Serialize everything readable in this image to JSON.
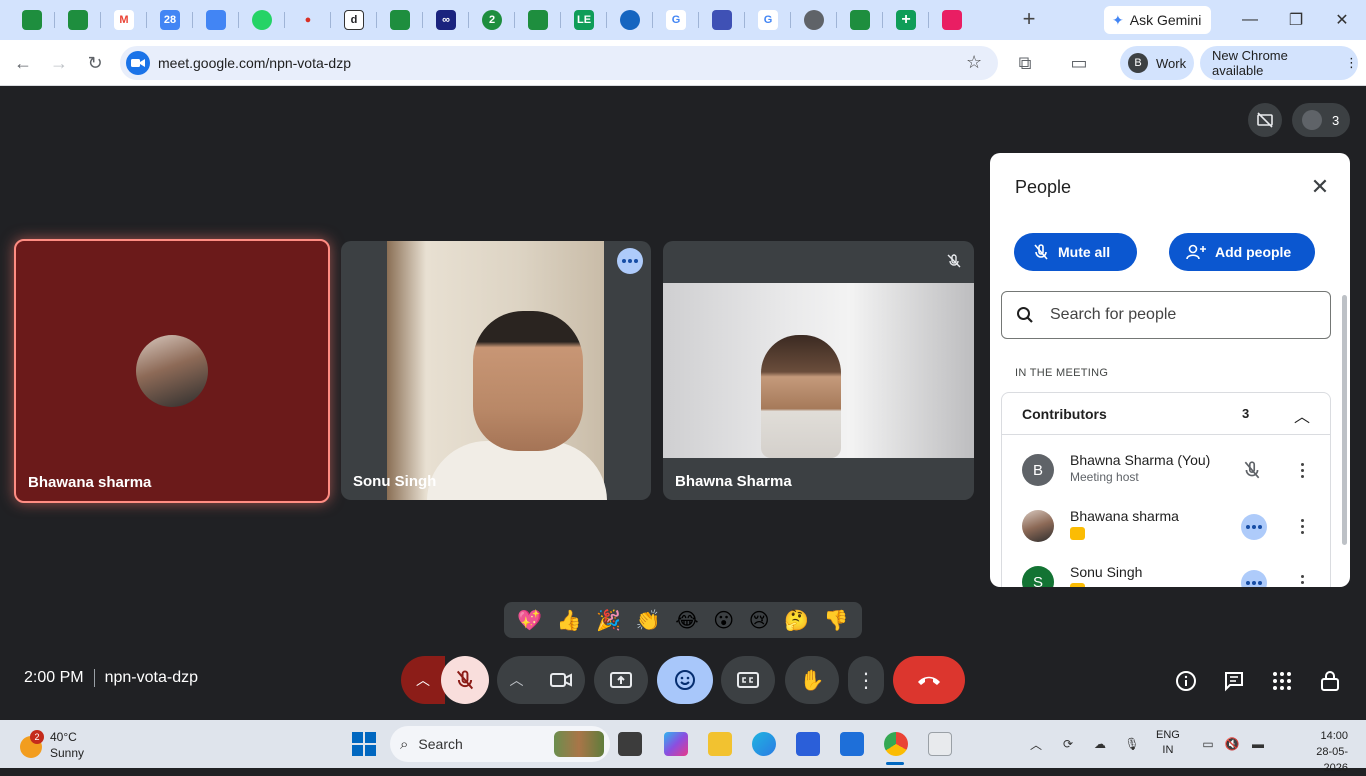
{
  "browser": {
    "new_tab_icon": "plus",
    "ask_gemini_label": "Ask Gemini",
    "url": "meet.google.com/npn-vota-dzp",
    "profile_initial": "B",
    "profile_label": "Work",
    "update_label": "New Chrome available",
    "tab_favicons": [
      "sheets-icon",
      "sheets-icon",
      "gmail-icon",
      "calendar-icon",
      "docs-icon",
      "whatsapp-icon",
      "app-icon",
      "d-icon",
      "sheets-icon",
      "loop-icon",
      "two-icon",
      "sheets-icon",
      "le-icon",
      "app-icon",
      "google-icon",
      "app-icon",
      "google-icon",
      "globe-icon",
      "sheets-icon",
      "sheets-plus-icon",
      "shield-icon"
    ]
  },
  "meet": {
    "participants_count": "3",
    "tiles": [
      {
        "name": "Bhawana sharma",
        "state": "avatar"
      },
      {
        "name": "Sonu Singh",
        "state": "video"
      },
      {
        "name": "Bhawna Sharma",
        "state": "video-muted"
      }
    ],
    "time": "2:00 PM",
    "meeting_code": "npn-vota-dzp",
    "reactions": [
      "💖",
      "👍",
      "🎉",
      "👏",
      "😂",
      "😮",
      "😢",
      "🤔",
      "👎"
    ]
  },
  "people_panel": {
    "title": "People",
    "mute_all_label": "Mute all",
    "add_people_label": "Add people",
    "search_placeholder": "Search for people",
    "section_label": "IN THE MEETING",
    "group_title": "Contributors",
    "group_count": "3",
    "participants": [
      {
        "initial": "B",
        "name": "Bhawna Sharma (You)",
        "sub": "Meeting host",
        "avatar_color": "#5f6368"
      },
      {
        "initial": "",
        "name": "Bhawana sharma",
        "sub": "",
        "avatar_color": "#8d6a57"
      },
      {
        "initial": "S",
        "name": "Sonu Singh",
        "sub": "",
        "avatar_color": "#137333"
      }
    ]
  },
  "taskbar": {
    "weather_badge": "2",
    "temperature": "40°C",
    "condition": "Sunny",
    "search_label": "Search",
    "lang_line1": "ENG",
    "lang_line2": "IN",
    "time": "14:00",
    "date": "28-05-2026"
  },
  "colors": {
    "meet_bg": "#202124",
    "speaking_border": "#ff8d83",
    "leave_red": "#dc362e",
    "primary_blue": "#0b57d0"
  }
}
